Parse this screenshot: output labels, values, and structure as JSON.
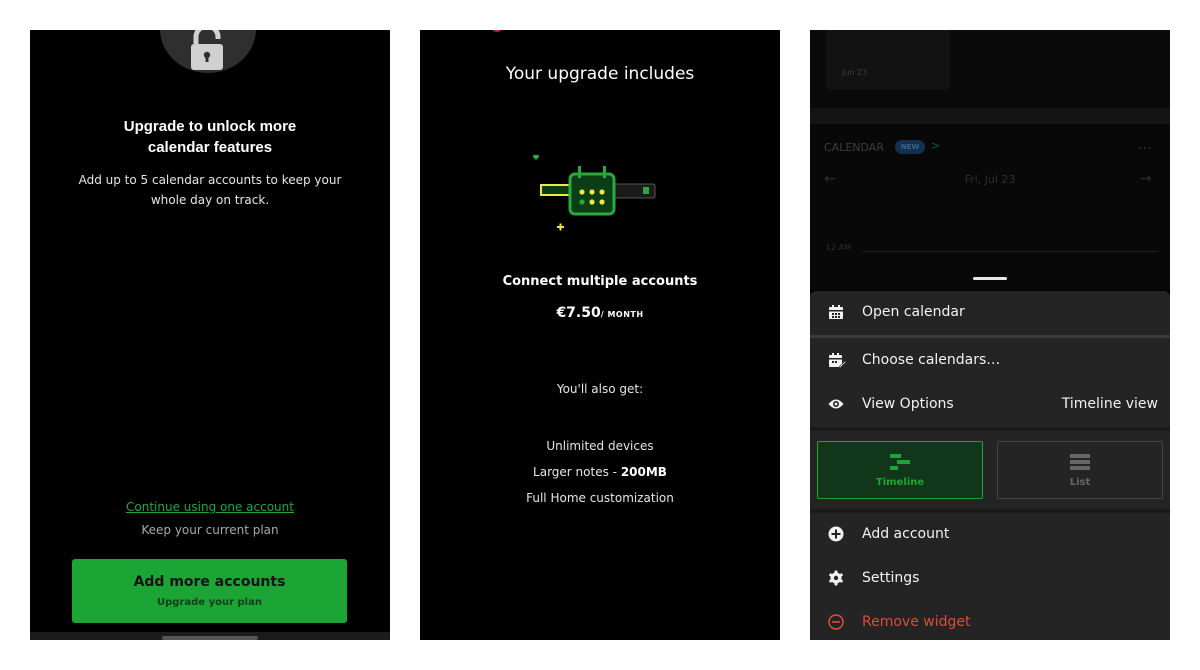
{
  "panel1": {
    "icon": "unlock-icon",
    "title": "Upgrade to unlock more\ncalendar features",
    "subtitle": "Add up to 5 calendar accounts to keep your whole day on track.",
    "continue_link": "Continue using one account",
    "keep_plan": "Keep your current plan",
    "button_title": "Add more accounts",
    "button_subtitle": "Upgrade your plan",
    "accent": "#1aa534"
  },
  "panel2": {
    "title": "Your upgrade includes",
    "illustration": "calendar-connect-illustration",
    "feature": "Connect multiple accounts",
    "price": "€7.50",
    "price_unit": "/ MONTH",
    "also_get": "You'll also get:",
    "benefits": {
      "unlimited": "Unlimited devices",
      "notes_prefix": "Larger notes - ",
      "notes_size": "200MB",
      "home": "Full Home customization"
    }
  },
  "panel3": {
    "background": {
      "thumb_date": "Jun 23",
      "calendar_label": "CALENDAR",
      "new_badge": "NEW",
      "chevron": ">",
      "more": "...",
      "prev_arrow": "←",
      "date": "Fri, Jul 23",
      "next_arrow": "→",
      "time_label": "12 AM"
    },
    "menu": {
      "open_calendar": "Open calendar",
      "choose_calendars": "Choose calendars…",
      "view_options": "View Options",
      "view_options_value": "Timeline view",
      "timeline": "Timeline",
      "list": "List",
      "add_account": "Add account",
      "settings": "Settings",
      "remove_widget": "Remove widget",
      "danger_color": "#e04a3a"
    }
  }
}
